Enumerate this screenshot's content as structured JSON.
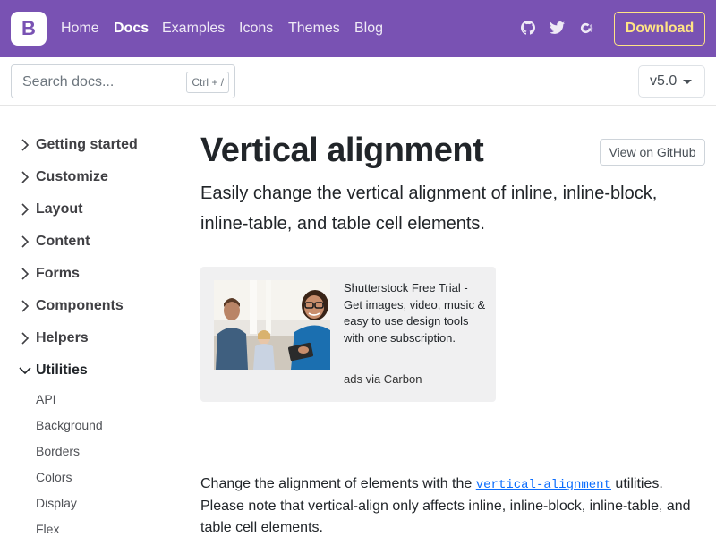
{
  "navbar": {
    "brand_letter": "B",
    "links": [
      "Home",
      "Docs",
      "Examples",
      "Icons",
      "Themes",
      "Blog"
    ],
    "active_link": "Docs",
    "icons": [
      "github-icon",
      "twitter-icon",
      "opencollective-icon"
    ],
    "download_label": "Download",
    "brand_color": "#7952b3",
    "download_color": "#ffe484"
  },
  "subheader": {
    "search_placeholder": "Search docs...",
    "search_shortcut": "Ctrl + /",
    "version": "v5.0"
  },
  "sidebar": {
    "sections": [
      {
        "label": "Getting started",
        "expanded": false
      },
      {
        "label": "Customize",
        "expanded": false
      },
      {
        "label": "Layout",
        "expanded": false
      },
      {
        "label": "Content",
        "expanded": false
      },
      {
        "label": "Forms",
        "expanded": false
      },
      {
        "label": "Components",
        "expanded": false
      },
      {
        "label": "Helpers",
        "expanded": false
      },
      {
        "label": "Utilities",
        "expanded": true
      }
    ],
    "utilities_items": [
      "API",
      "Background",
      "Borders",
      "Colors",
      "Display",
      "Flex"
    ]
  },
  "main": {
    "title": "Vertical alignment",
    "github_button": "View on GitHub",
    "lead": "Easily change the vertical alignment of inline, inline-block, inline-table, and table cell elements.",
    "ad": {
      "text": "Shutterstock Free Trial - Get images, video, music & easy to use design tools with one subscription.",
      "powered_by": "ads via Carbon"
    },
    "body": {
      "before_code": "Change the alignment of elements with the ",
      "code": "vertical-alignment",
      "after_code": " utilities. Please note that vertical-align only affects inline, inline-block, inline-table, and table cell elements."
    }
  }
}
